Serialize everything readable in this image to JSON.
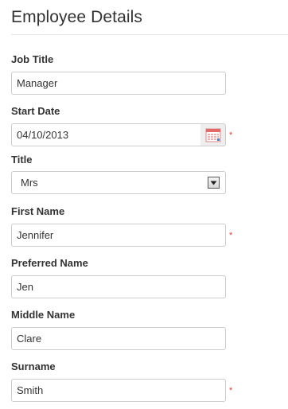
{
  "page": {
    "title": "Employee Details"
  },
  "form": {
    "job_title": {
      "label": "Job Title",
      "value": "Manager"
    },
    "start_date": {
      "label": "Start Date",
      "value": "04/10/2013",
      "required_mark": "*"
    },
    "title": {
      "label": "Title",
      "selected": "Mrs"
    },
    "first_name": {
      "label": "First Name",
      "value": "Jennifer",
      "required_mark": "*"
    },
    "preferred_name": {
      "label": "Preferred Name",
      "value": "Jen"
    },
    "middle_name": {
      "label": "Middle Name",
      "value": "Clare"
    },
    "surname": {
      "label": "Surname",
      "value": "Smith",
      "required_mark": "*"
    }
  },
  "icons": {
    "calendar": "calendar-icon",
    "dropdown": "dropdown-arrow-icon"
  },
  "colors": {
    "required": "#e03c3c",
    "border": "#cccccc",
    "text": "#333333"
  }
}
